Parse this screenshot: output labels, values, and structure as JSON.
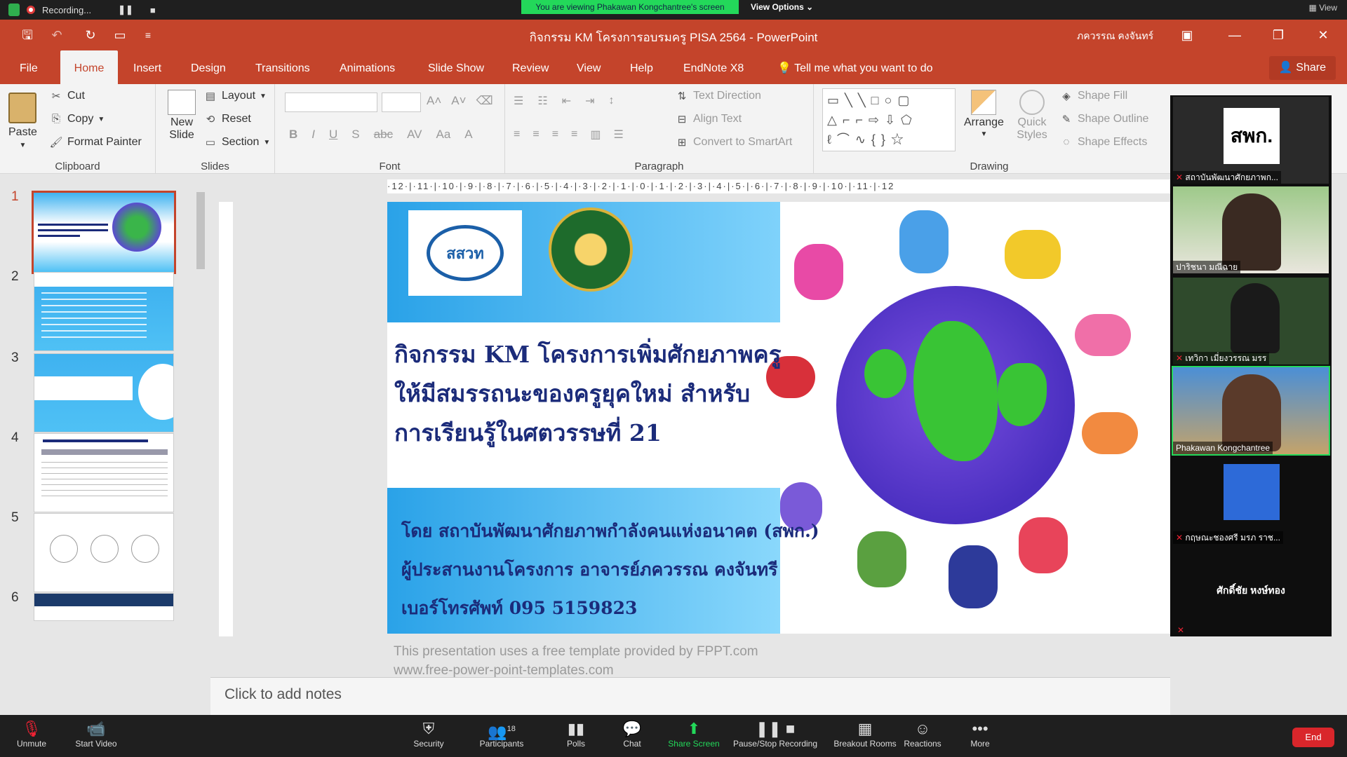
{
  "zoom_top": {
    "recording_label": "Recording...",
    "viewing_banner": "You are viewing Phakawan Kongchantree's screen",
    "view_options": "View Options ⌄",
    "view_label": "View"
  },
  "titlebar": {
    "title": "กิจกรรม KM โครงการอบรมครู PISA 2564  -  PowerPoint",
    "user": "ภควรรณ คงจันทร์"
  },
  "tabs": [
    "File",
    "Home",
    "Insert",
    "Design",
    "Transitions",
    "Animations",
    "Slide Show",
    "Review",
    "View",
    "Help",
    "EndNote X8"
  ],
  "tell_me": "Tell me what you want to do",
  "share": "Share",
  "ribbon": {
    "clipboard": {
      "paste": "Paste",
      "cut": "Cut",
      "copy": "Copy",
      "format_painter": "Format Painter",
      "label": "Clipboard"
    },
    "slides": {
      "new_slide": "New Slide",
      "layout": "Layout",
      "reset": "Reset",
      "section": "Section",
      "label": "Slides"
    },
    "font": {
      "label": "Font"
    },
    "paragraph": {
      "text_direction": "Text Direction",
      "align_text": "Align Text",
      "convert_smartart": "Convert to SmartArt",
      "label": "Paragraph"
    },
    "drawing": {
      "arrange": "Arrange",
      "quick_styles": "Quick Styles",
      "shape_fill": "Shape Fill",
      "shape_outline": "Shape Outline",
      "shape_effects": "Shape Effects",
      "label": "Drawing"
    }
  },
  "thumbnails": [
    "1",
    "2",
    "3",
    "4",
    "5",
    "6"
  ],
  "ruler_text": "·12·|·11·|·10·|·9·|·8·|·7·|·6·|·5·|·4·|·3·|·2·|·1·|·0·|·1·|·2·|·3·|·4·|·5·|·6·|·7·|·8·|·9·|·10·|·11·|·12",
  "slide": {
    "logo1_text": "สสวท",
    "title_lines": [
      "กิจกรรม KM โครงการเพิ่มศักยภาพครู",
      "ให้มีสมรรถนะของครูยุคใหม่ สำหรับ",
      "การเรียนรู้ในศตวรรษที่ 21"
    ],
    "sub_lines": [
      "โดย สถาบันพัฒนาศักยภาพกำลังคนแห่งอนาคต (สพก.)",
      "ผู้ประสานงานโครงการ อาจารย์ภควรรณ คงจันทรี",
      "เบอร์โทรศัพท์ 095 5159823"
    ],
    "footer_1": "This presentation uses a free template provided by FPPT.com",
    "footer_2": "www.free-power-point-templates.com"
  },
  "notes_placeholder": "Click to add notes",
  "participants": [
    {
      "name": "สถาบันพัฒนาศักยภาพก...",
      "logo": "สพก."
    },
    {
      "name": "ปาริชนา มณีฉาย"
    },
    {
      "name": "เทวิกา เมี่ยงวรรณ มรร"
    },
    {
      "name": "Phakawan Kongchantree"
    },
    {
      "name": "กฤษณะชองศรี มรภ ราช..."
    },
    {
      "name": "ศักดิ์ชัย หงษ์ทอง"
    }
  ],
  "zoom_bottom": {
    "unmute": "Unmute",
    "start_video": "Start Video",
    "security": "Security",
    "participants": "Participants",
    "participants_count": "18",
    "polls": "Polls",
    "chat": "Chat",
    "share_screen": "Share Screen",
    "pause_recording": "Pause/Stop Recording",
    "breakout": "Breakout Rooms",
    "reactions": "Reactions",
    "more": "More",
    "end": "End"
  }
}
